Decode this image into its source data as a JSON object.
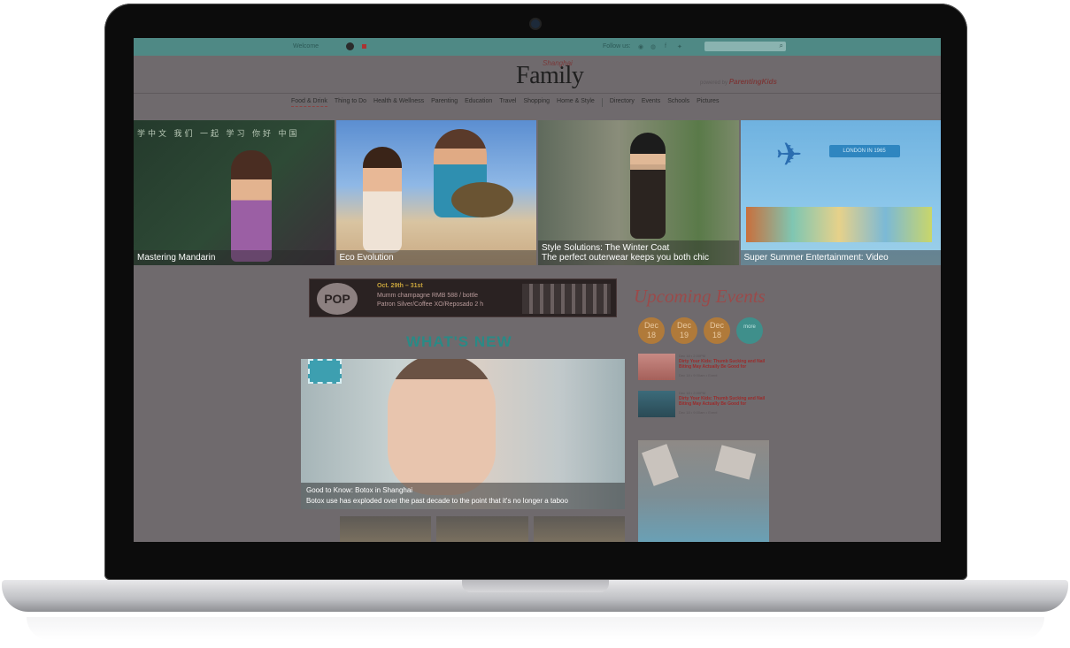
{
  "topbar": {
    "welcome": "Welcome",
    "follow": "Follow us:",
    "search_placeholder": ""
  },
  "logo": {
    "small": "Shanghai",
    "main": "Family",
    "powered_by": "powered by",
    "brand": "ParentingKids"
  },
  "nav": {
    "items": [
      "Food & Drink",
      "Thing to Do",
      "Health & Wellness",
      "Parenting",
      "Education",
      "Travel",
      "Shopping",
      "Home & Style"
    ],
    "extra": [
      "Directory",
      "Events",
      "Schools",
      "Pictures"
    ]
  },
  "heroes": [
    {
      "caption": "Mastering Mandarin",
      "board": "学中文 我们 一起 学习 你好 中国"
    },
    {
      "caption": "Eco Evolution"
    },
    {
      "caption": "Style Solutions: The Winter Coat",
      "sub": "The perfect outerwear keeps you both chic"
    },
    {
      "caption": "Super Summer Entertainment: Video",
      "banner": "LONDON IN 1965"
    }
  ],
  "ad": {
    "logo": "POP",
    "line1": "Oct. 29th – 31st",
    "line2": "Mumm champagne RMB 588 / bottle",
    "line3": "Patron Silver/Coffee XO/Reposado 2 h"
  },
  "whats_new": "WHAT'S NEW",
  "feature": {
    "title": "Good to Know: Botox in Shanghai",
    "desc": "Botox use has exploded over the past decade to the point that it's no longer a taboo"
  },
  "upcoming": {
    "title": "Upcoming Events",
    "dates": [
      {
        "month": "Dec",
        "day": "18"
      },
      {
        "month": "Dec",
        "day": "19"
      },
      {
        "month": "Dec",
        "day": "18"
      }
    ],
    "more": "more",
    "events": [
      {
        "meta": "Dec 18 • 2:00PM",
        "title": "Dirty Your Kids: Thumb Sucking and Nail Biting May Actually Be Good for",
        "foot": "Dec 18 • 9:00am • Event"
      },
      {
        "meta": "Dec 18 • 2:00PM",
        "title": "Dirty Your Kids: Thumb Sucking and Nail Biting May Actually Be Good for",
        "foot": "Dec 18 • 9:00am • Event"
      }
    ]
  }
}
